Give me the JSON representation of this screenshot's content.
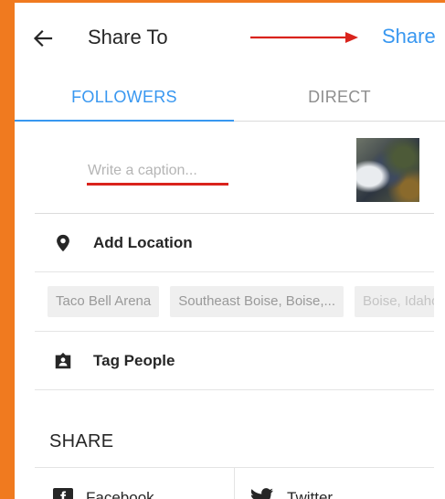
{
  "header": {
    "title": "Share To",
    "share_label": "Share",
    "back_icon": "arrow-left-icon"
  },
  "tabs": [
    {
      "label": "FOLLOWERS",
      "active": true
    },
    {
      "label": "DIRECT",
      "active": false
    }
  ],
  "caption": {
    "placeholder": "Write a caption...",
    "value": ""
  },
  "location": {
    "label": "Add Location",
    "icon": "location-pin-icon",
    "suggestions": [
      "Taco Bell Arena",
      "Southeast Boise, Boise,...",
      "Boise, Idaho"
    ]
  },
  "tag_people": {
    "label": "Tag People",
    "icon": "tag-person-icon"
  },
  "share_section": {
    "heading": "SHARE",
    "options": [
      {
        "label": "Facebook",
        "icon": "facebook-icon"
      },
      {
        "label": "Twitter",
        "icon": "twitter-icon"
      }
    ]
  },
  "colors": {
    "accent": "#3897f0",
    "annotation_red": "#d9231c",
    "frame_orange": "#f07a1f",
    "text": "#262626",
    "muted": "#8e8e8e"
  }
}
